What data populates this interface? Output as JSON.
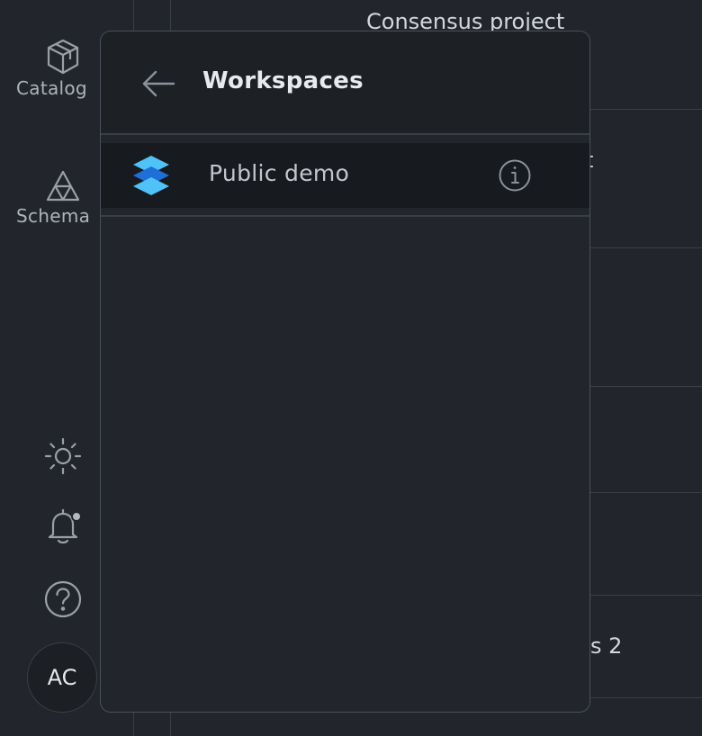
{
  "sidebar": {
    "items": [
      {
        "label": "Catalog",
        "icon": "catalog-icon"
      },
      {
        "label": "Schema",
        "icon": "schema-icon"
      }
    ],
    "bottom_icons": [
      "sun-icon",
      "bell-icon",
      "help-icon"
    ],
    "avatar_initials": "AC"
  },
  "background": {
    "row_texts": [
      "Consensus project",
      "t",
      "s 2"
    ]
  },
  "panel": {
    "title": "Workspaces",
    "workspaces": [
      {
        "name": "Public demo",
        "icon": "layers-logo-icon"
      }
    ]
  },
  "colors": {
    "background": "#22262c",
    "panel_header": "#1d2126",
    "selected_row": "#171a1e",
    "logo_light": "#4fc3f7",
    "logo_dark": "#1e6fd9"
  }
}
